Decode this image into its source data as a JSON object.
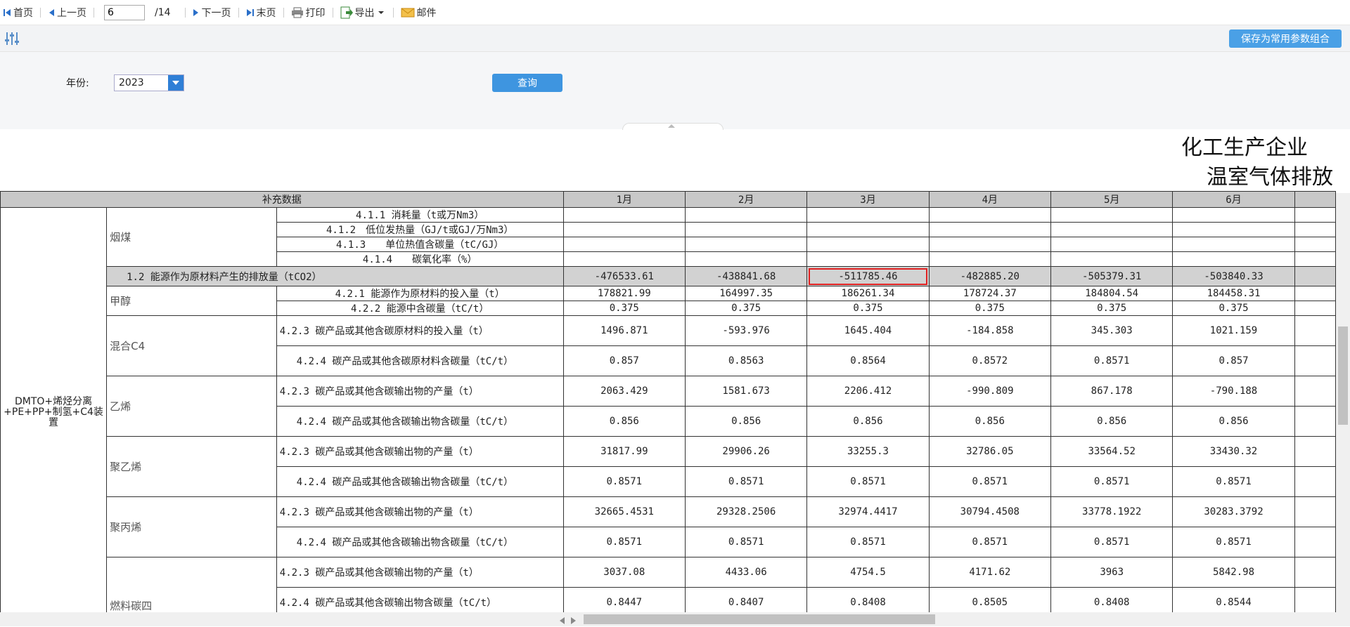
{
  "toolbar": {
    "first": "首页",
    "prev": "上一页",
    "page": "6",
    "total": "/14",
    "next": "下一页",
    "last": "末页",
    "print": "打印",
    "export": "导出",
    "mail": "邮件"
  },
  "params": {
    "save_combo": "保存为常用参数组合",
    "year_label": "年份:",
    "year_value": "2023",
    "query": "查询"
  },
  "report": {
    "title_line1": "化工生产企业",
    "title_line2": "温室气体排放",
    "header": [
      "补充数据",
      "1月",
      "2月",
      "3月",
      "4月",
      "5月",
      "6月"
    ],
    "group": "DMTO+烯烃分离+PE+PP+制氢+C4装置",
    "categories": {
      "yanmei": "烟煤",
      "jiachun": "甲醇",
      "hunhe": "混合C4",
      "yixi": "乙烯",
      "juyixi": "聚乙烯",
      "jubingxi": "聚丙烯",
      "ranliao": "燃料碳四"
    },
    "rows": {
      "r1": {
        "label": "4.1.1 消耗量（t或万Nm3）"
      },
      "r2": {
        "label": "4.1.2　低位发热量（GJ/t或GJ/万Nm3）"
      },
      "r3": {
        "label": "4.1.3　　单位热值含碳量（tC/GJ）"
      },
      "r4": {
        "label": "4.1.4　　碳氧化率（%）"
      },
      "r5": {
        "label": "1.2 能源作为原材料产生的排放量（tCO2）",
        "v": [
          "-476533.61",
          "-438841.68",
          "-511785.46",
          "-482885.20",
          "-505379.31",
          "-503840.33"
        ]
      },
      "r6": {
        "label": "4.2.1 能源作为原材料的投入量（t）",
        "v": [
          "178821.99",
          "164997.35",
          "186261.34",
          "178724.37",
          "184804.54",
          "184458.31"
        ]
      },
      "r7": {
        "label": "4.2.2 能源中含碳量（tC/t）",
        "v": [
          "0.375",
          "0.375",
          "0.375",
          "0.375",
          "0.375",
          "0.375"
        ]
      },
      "r8": {
        "label": "4.2.3 碳产品或其他含碳原材料的投入量（t）",
        "v": [
          "1496.871",
          "-593.976",
          "1645.404",
          "-184.858",
          "345.303",
          "1021.159"
        ]
      },
      "r9": {
        "label": "4.2.4 碳产品或其他含碳原材料含碳量（tC/t）",
        "v": [
          "0.857",
          "0.8563",
          "0.8564",
          "0.8572",
          "0.8571",
          "0.857"
        ]
      },
      "r10": {
        "label": "4.2.3 碳产品或其他含碳输出物的产量（t）",
        "v": [
          "2063.429",
          "1581.673",
          "2206.412",
          "-990.809",
          "867.178",
          "-790.188"
        ]
      },
      "r11": {
        "label": "4.2.4 碳产品或其他含碳输出物含碳量（tC/t）",
        "v": [
          "0.856",
          "0.856",
          "0.856",
          "0.856",
          "0.856",
          "0.856"
        ]
      },
      "r12": {
        "label": "4.2.3 碳产品或其他含碳输出物的产量（t）",
        "v": [
          "31817.99",
          "29906.26",
          "33255.3",
          "32786.05",
          "33564.52",
          "33430.32"
        ]
      },
      "r13": {
        "label": "4.2.4 碳产品或其他含碳输出物含碳量（tC/t）",
        "v": [
          "0.8571",
          "0.8571",
          "0.8571",
          "0.8571",
          "0.8571",
          "0.8571"
        ]
      },
      "r14": {
        "label": "4.2.3 碳产品或其他含碳输出物的产量（t）",
        "v": [
          "32665.4531",
          "29328.2506",
          "32974.4417",
          "30794.4508",
          "33778.1922",
          "30283.3792"
        ]
      },
      "r15": {
        "label": "4.2.4 碳产品或其他含碳输出物含碳量（tC/t）",
        "v": [
          "0.8571",
          "0.8571",
          "0.8571",
          "0.8571",
          "0.8571",
          "0.8571"
        ]
      },
      "r16": {
        "label": "4.2.3 碳产品或其他含碳输出物的产量（t）",
        "v": [
          "3037.08",
          "4433.06",
          "4754.5",
          "4171.62",
          "3963",
          "5842.98"
        ]
      },
      "r17": {
        "label": "4.2.4 碳产品或其他含碳输出物含碳量（tC/t）",
        "v": [
          "0.8447",
          "0.8407",
          "0.8408",
          "0.8505",
          "0.8408",
          "0.8544"
        ]
      }
    }
  },
  "colors": {
    "accent": "#3e95e0",
    "header_bg": "#c8c8c8",
    "highlight": "#e02020"
  }
}
